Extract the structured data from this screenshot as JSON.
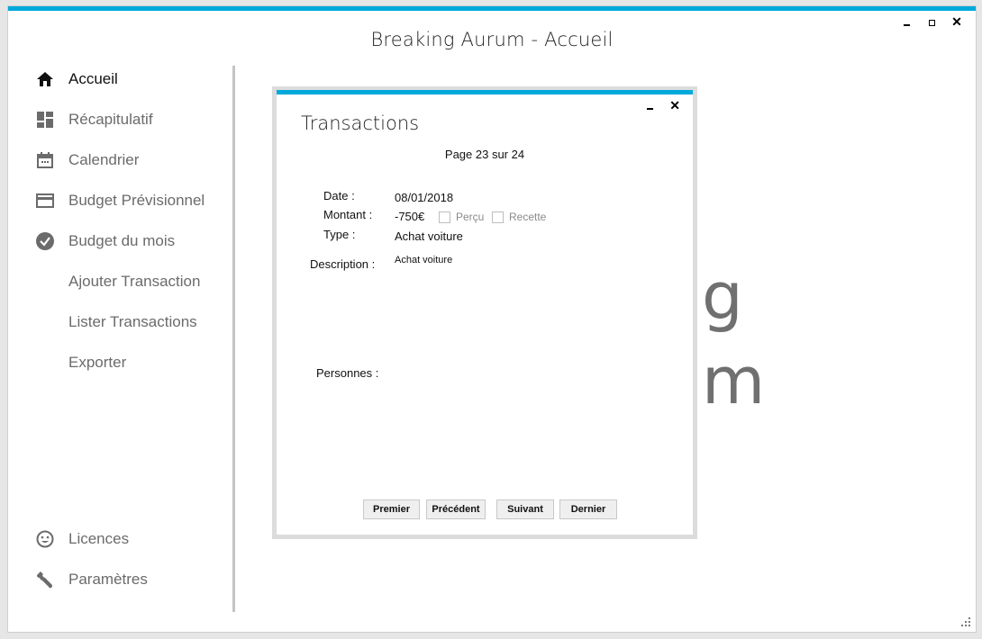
{
  "window": {
    "title": "Breaking Aurum - Accueil",
    "controls": [
      "minimize",
      "maximize",
      "close"
    ],
    "accent_color": "#00a9db"
  },
  "sidebar": {
    "items": [
      {
        "label": "Accueil",
        "icon": "home-icon",
        "active": true
      },
      {
        "label": "Récapitulatif",
        "icon": "dashboard-icon",
        "active": false
      },
      {
        "label": "Calendrier",
        "icon": "calendar-icon",
        "active": false
      },
      {
        "label": "Budget Prévisionnel",
        "icon": "credit-card-icon",
        "active": false
      },
      {
        "label": "Budget du mois",
        "icon": "check-circle-icon",
        "active": false
      },
      {
        "label": "Ajouter Transaction",
        "icon": null,
        "active": false
      },
      {
        "label": "Lister Transactions",
        "icon": null,
        "active": false
      },
      {
        "label": "Exporter",
        "icon": null,
        "active": false
      }
    ],
    "bottom_items": [
      {
        "label": "Licences",
        "icon": "smiley-icon"
      },
      {
        "label": "Paramètres",
        "icon": "wrench-icon"
      }
    ]
  },
  "background": {
    "partial_text_line1": "g",
    "partial_text_line2": "m"
  },
  "modal": {
    "title": "Transactions",
    "page_indicator": "Page 23 sur 24",
    "fields": {
      "date_label": "Date :",
      "date_value": "08/01/2018",
      "amount_label": "Montant :",
      "amount_value": "-750€",
      "received_label": "Perçu",
      "received_checked": false,
      "income_label": "Recette",
      "income_checked": false,
      "type_label": "Type :",
      "type_value": "Achat voiture",
      "description_label": "Description :",
      "description_value": "Achat voiture",
      "persons_label": "Personnes :"
    },
    "buttons": {
      "first": "Premier",
      "previous": "Précédent",
      "next": "Suivant",
      "last": "Dernier"
    }
  }
}
